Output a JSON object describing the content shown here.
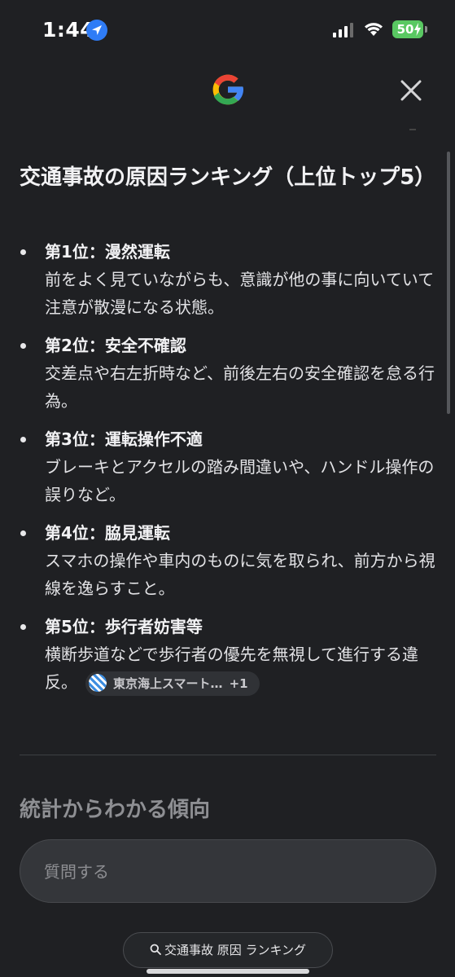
{
  "status_bar": {
    "time": "1:44",
    "battery": "50",
    "icons": [
      "location-arrow-icon",
      "cellular-signal-icon",
      "wifi-icon",
      "battery-charging-icon"
    ]
  },
  "header": {
    "logo": "google-g-logo",
    "close_icon": "close-icon"
  },
  "content": {
    "heading": "交通事故の原因ランキング（上位トップ5）",
    "items": [
      {
        "title": "第1位：漫然運転",
        "desc": "前をよく見ていながらも、意識が他の事に向いていて注意が散漫になる状態。"
      },
      {
        "title": "第2位：安全不確認",
        "desc": "交差点や右左折時など、前後左右の安全確認を怠る行為。"
      },
      {
        "title": "第3位：運転操作不適",
        "desc": "ブレーキとアクセルの踏み間違いや、ハンドル操作の誤りなど。"
      },
      {
        "title": "第4位：脇見運転",
        "desc": "スマホの操作や車内のものに気を取られ、前方から視線を逸らすこと。"
      },
      {
        "title": "第5位：歩行者妨害等",
        "desc": "横断歩道などで歩行者の優先を無視して進行する違反。"
      }
    ],
    "source_chip": {
      "label": "東京海上スマート…",
      "extra": "+1"
    },
    "section_heading": "統計からわかる傾向"
  },
  "ask": {
    "placeholder": "質問する"
  },
  "suggestion": {
    "label": "交通事故 原因 ランキング"
  },
  "colors": {
    "background": "#1f2023",
    "location_blue": "#2f7cf6",
    "battery_green": "#59c862",
    "google_blue": "#4285F4",
    "google_red": "#EA4335",
    "google_yellow": "#FBBC05",
    "google_green": "#34A853"
  }
}
